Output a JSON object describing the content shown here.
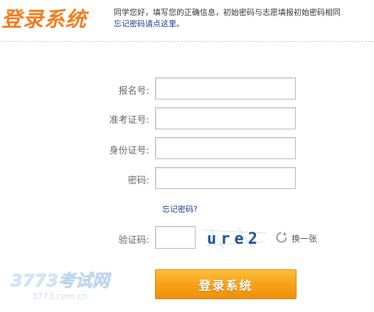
{
  "header": {
    "title": "登录系统",
    "description": "同学您好，填写您的正确信息，初始密码与志愿填报初始密码相同",
    "forgot_link": "忘记密码请点这里。"
  },
  "form": {
    "fields": [
      {
        "label": "报名号:",
        "value": ""
      },
      {
        "label": "准考证号:",
        "value": ""
      },
      {
        "label": "身份证号:",
        "value": ""
      },
      {
        "label": "密码:",
        "value": ""
      }
    ],
    "forgot_password": "忘记密码?",
    "captcha": {
      "label": "验证码:",
      "value": "",
      "image_text": "ure2",
      "refresh_label": "换一张"
    },
    "submit_label": "登录系统"
  },
  "watermark": {
    "brand": "3773考试网",
    "url": "3773.com.cn"
  },
  "colors": {
    "accent": "#f07d1f",
    "link": "#1a3a8c",
    "button_top": "#fbbf3c",
    "button_bottom": "#f08f0c"
  }
}
